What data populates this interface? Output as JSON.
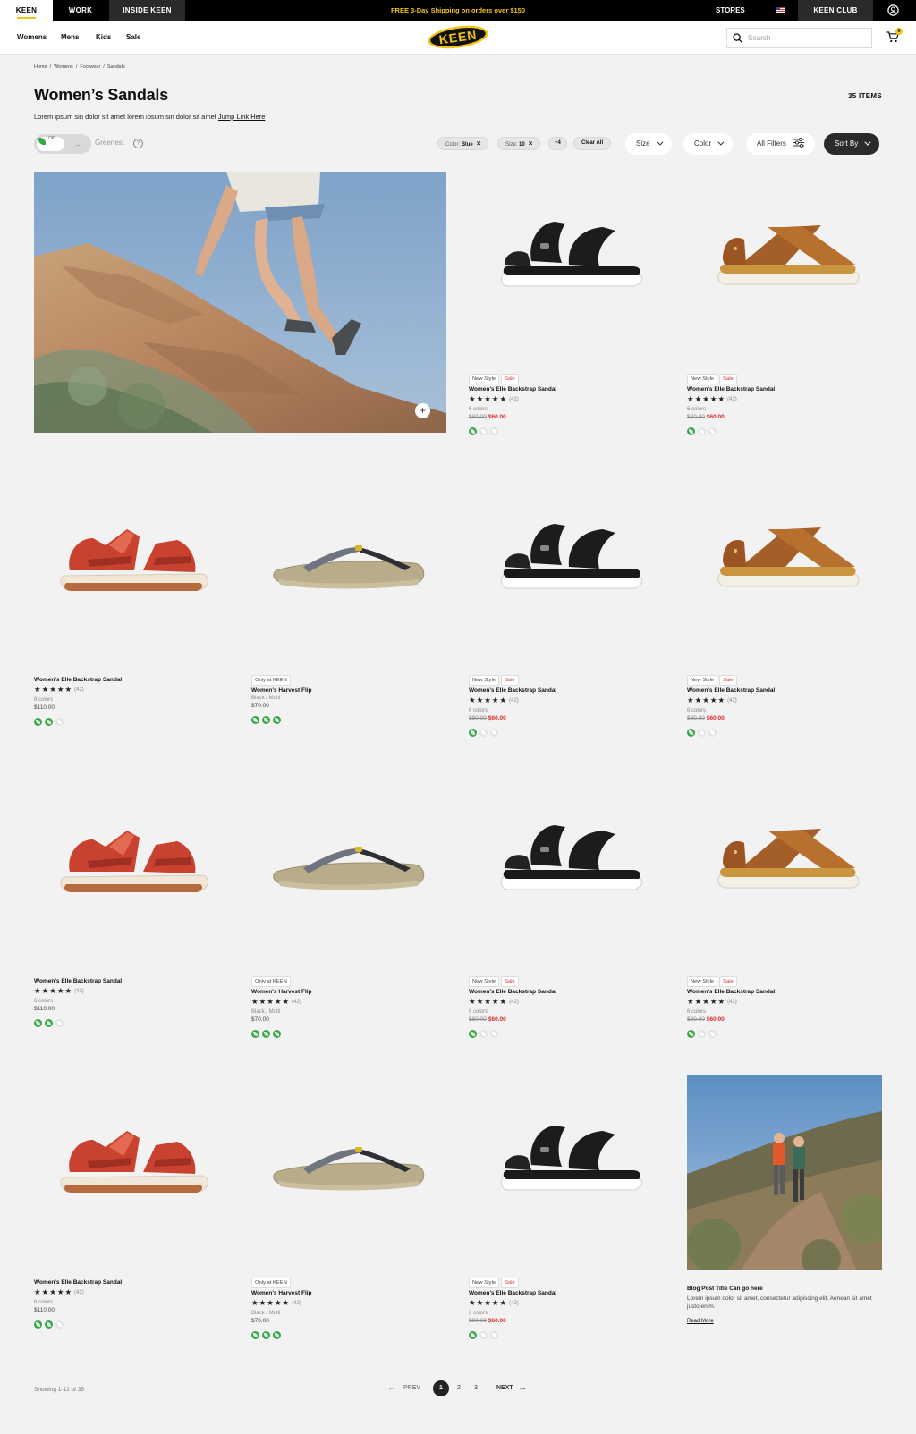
{
  "topbar": {
    "tabs": [
      {
        "label": "KEEN"
      },
      {
        "label": "WORK"
      },
      {
        "label": "INSIDE KEEN"
      }
    ],
    "promo": "FREE 3-Day Shipping on orders over $150",
    "stores": "STORES",
    "club": "KEEN CLUB"
  },
  "nav": {
    "links": [
      {
        "label": "Womens"
      },
      {
        "label": "Mens"
      },
      {
        "label": "Kids"
      },
      {
        "label": "Sale"
      }
    ],
    "logo": "KEEN",
    "search_placeholder": "Search",
    "cart_count": "0"
  },
  "breadcrumb": [
    "Home",
    "/",
    "Womens",
    "/",
    "Footwear",
    "/",
    "Sandals"
  ],
  "page": {
    "title": "Women’s Sandals",
    "items": "35 ITEMS",
    "intro": "Lorem ipsum sin dolor sit amet lorem ipsum sin dolor sit amet",
    "jump": "Jump Link Here"
  },
  "filters": {
    "toggle_state": "Off",
    "greenest": "Greenest",
    "help": "?",
    "chip_color_label": "Color:",
    "chip_color_value": "Blue",
    "chip_size_label": "Size:",
    "chip_size_value": "10",
    "chip_more": "+4",
    "clear_all": "Clear All",
    "size": "Size",
    "color": "Color",
    "all_filters": "All Filters",
    "sort_by": "Sort By"
  },
  "products": [
    {
      "new_style": "New Style",
      "sale": "Sale",
      "name": "Women's Elle Backstrap Sandal",
      "stars": "★★★★★",
      "reviews": "(42)",
      "colors": "6 colors",
      "old_price": "$80.00",
      "price": "$60.00"
    },
    {
      "new_style": "New Style",
      "sale": "Sale",
      "name": "Women's Elle Backstrap Sandal",
      "stars": "★★★★★",
      "reviews": "(42)",
      "colors": "6 colors",
      "old_price": "$80.00",
      "price": "$60.00"
    },
    {
      "name": "Women's Elle Backstrap Sandal",
      "stars": "★★★★★",
      "reviews": "(42)",
      "colors": "6 colors",
      "price": "$110.00"
    },
    {
      "only": "Only at KEEN",
      "name": "Women's Harvest Flip",
      "colors": "Black / Multi",
      "price": "$70.00"
    },
    {
      "new_style": "New Style",
      "sale": "Sale",
      "name": "Women's Elle Backstrap Sandal",
      "stars": "★★★★★",
      "reviews": "(42)",
      "colors": "6 colors",
      "old_price": "$80.00",
      "price": "$60.00"
    },
    {
      "new_style": "New Style",
      "sale": "Sale",
      "name": "Women's Elle Backstrap Sandal",
      "stars": "★★★★★",
      "reviews": "(42)",
      "colors": "6 colors",
      "old_price": "$80.00",
      "price": "$60.00"
    },
    {
      "name": "Women's Elle Backstrap Sandal",
      "stars": "★★★★★",
      "reviews": "(42)",
      "colors": "6 colors",
      "price": "$110.00"
    },
    {
      "only": "Only at KEEN",
      "name": "Women's Harvest Flip",
      "stars": "★★★★★",
      "reviews": "(42)",
      "colors": "Black / Multi",
      "price": "$70.00"
    },
    {
      "new_style": "New Style",
      "sale": "Sale",
      "name": "Women's Elle Backstrap Sandal",
      "stars": "★★★★★",
      "reviews": "(42)",
      "colors": "6 colors",
      "old_price": "$80.00",
      "price": "$60.00"
    },
    {
      "new_style": "New Style",
      "sale": "Sale",
      "name": "Women's Elle Backstrap Sandal",
      "stars": "★★★★★",
      "reviews": "(42)",
      "colors": "6 colors",
      "old_price": "$80.00",
      "price": "$60.00"
    },
    {
      "name": "Women's Elle Backstrap Sandal",
      "stars": "★★★★★",
      "reviews": "(42)",
      "colors": "6 colors",
      "price": "$110.00"
    },
    {
      "only": "Only at KEEN",
      "name": "Women's Harvest Flip",
      "stars": "★★★★★",
      "reviews": "(42)",
      "colors": "Black / Multi",
      "price": "$70.00"
    },
    {
      "new_style": "New Style",
      "sale": "Sale",
      "name": "Women's Elle Backstrap Sandal",
      "stars": "★★★★★",
      "reviews": "(42)",
      "colors": "6 colors",
      "old_price": "$80.00",
      "price": "$60.00"
    }
  ],
  "blog": {
    "title": "Blog Post Title Can go here",
    "text": "Lorem ipsum dolor sit amet, consectetur adipiscing elit. Aenean sit amet justo enim.",
    "link": "Read More"
  },
  "pagination": {
    "showing": "Showing 1-12 of 35",
    "prev": "PREV",
    "pages": [
      "1",
      "2",
      "3"
    ],
    "next": "NEXT"
  },
  "colors": {
    "accent": "#f0c419",
    "sale": "#d92b2b",
    "eco_green": "#3aa64a"
  }
}
